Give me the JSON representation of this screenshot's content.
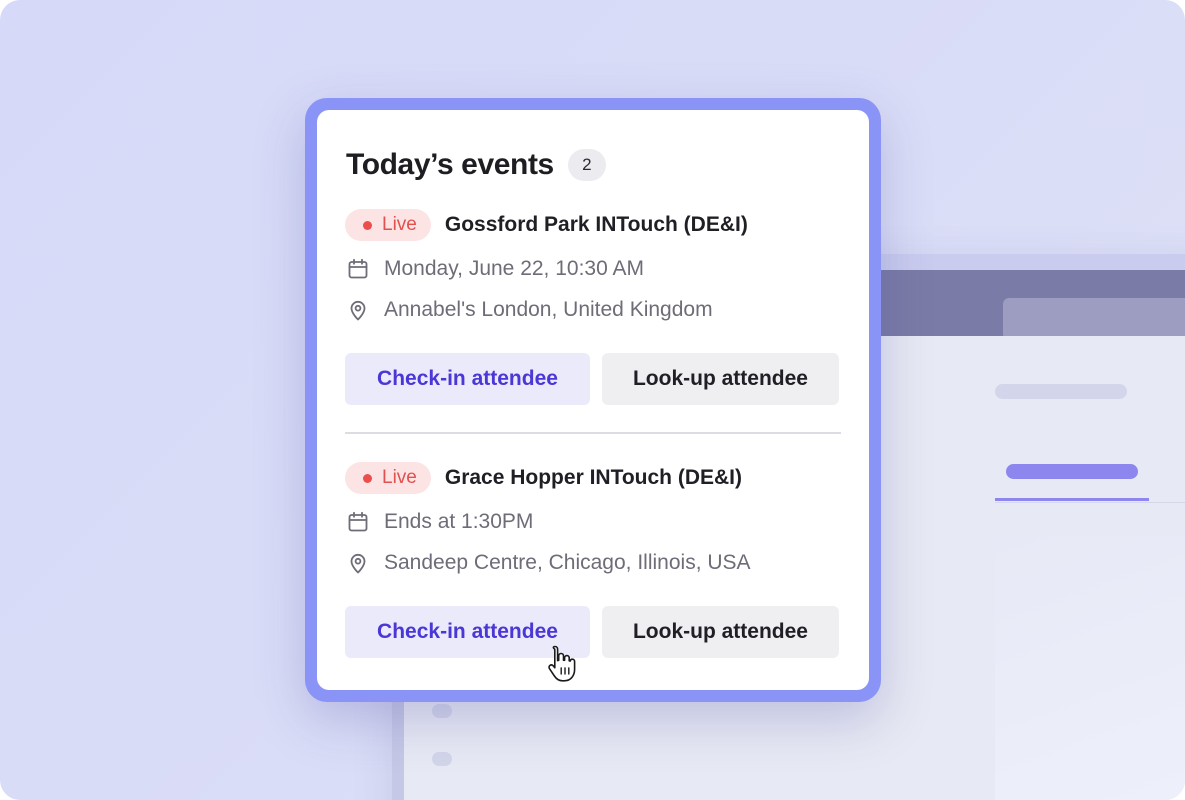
{
  "card": {
    "title": "Today’s events",
    "count": "2"
  },
  "events": [
    {
      "status": "Live",
      "name": "Gossford Park INTouch (DE&I)",
      "time": "Monday, June 22, 10:30 AM",
      "location": "Annabel's London, United Kingdom",
      "primary_action": "Check-in attendee",
      "secondary_action": "Look-up attendee"
    },
    {
      "status": "Live",
      "name": "Grace Hopper INTouch (DE&I)",
      "time": "Ends at 1:30PM",
      "location": "Sandeep Centre, Chicago, Illinois, USA",
      "primary_action": "Check-in attendee",
      "secondary_action": "Look-up attendee"
    }
  ],
  "icons": {
    "date": "calendar-icon",
    "location": "map-pin-icon",
    "status": "live-dot",
    "pointer": "hand-pointer-cursor"
  },
  "colors": {
    "accent": "#4b36d6",
    "frame": "#8a93f6",
    "live": "#ec4e4b",
    "live_bg": "#fde4e4",
    "muted_text": "#6d6d78"
  }
}
